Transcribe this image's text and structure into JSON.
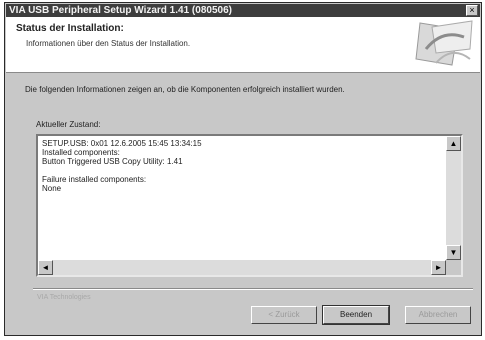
{
  "window": {
    "title": "VIA USB Peripheral Setup Wizard 1.41 (080506)",
    "close_glyph": "×"
  },
  "header": {
    "title": "Status der Installation:",
    "subtitle": "Informationen über den Status der Installation."
  },
  "intro_text": "Die folgenden Informationen zeigen an, ob die Komponenten erfolgreich installiert wurden.",
  "log": {
    "label": "Aktueller Zustand:",
    "text": "SETUP.USB: 0x01 12.6.2005 15:45 13:34:15\nInstalled components:\nButton Triggered USB Copy Utility: 1.41\n\nFailure installed components:\nNone"
  },
  "scroll": {
    "up_glyph": "▲",
    "down_glyph": "▼",
    "left_glyph": "◄",
    "right_glyph": "►"
  },
  "footer_brand": "VIA Technologies",
  "buttons": {
    "back_label": "< Zurück",
    "finish_label": "Beenden",
    "cancel_label": "Abbrechen"
  },
  "colors": {
    "titlebar": "#3d3d3d",
    "dialog_bg": "#c8c8c8"
  },
  "icons": [
    "close-icon",
    "wizard-logo-icon",
    "scroll-up-icon",
    "scroll-down-icon",
    "scroll-left-icon",
    "scroll-right-icon"
  ]
}
